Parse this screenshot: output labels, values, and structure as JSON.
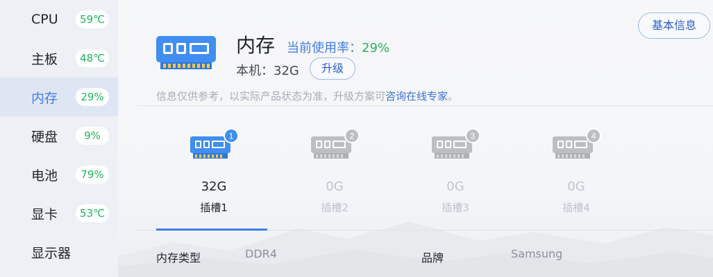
{
  "sidebar": {
    "items": [
      {
        "label": "CPU",
        "badge": "59℃"
      },
      {
        "label": "主板",
        "badge": "48℃"
      },
      {
        "label": "内存",
        "badge": "29%"
      },
      {
        "label": "硬盘",
        "badge": "9%"
      },
      {
        "label": "电池",
        "badge": "79%"
      },
      {
        "label": "显卡",
        "badge": "53℃"
      },
      {
        "label": "显示器",
        "badge": ""
      }
    ],
    "active_index": 2
  },
  "header": {
    "basic_info_label": "基本信息",
    "title": "内存",
    "usage_label": "当前使用率：",
    "usage_value": "29%",
    "local_label": "本机：32G",
    "upgrade_label": "升级"
  },
  "notice": {
    "text": "信息仅供参考，以实际产品状态为准，升级方案可",
    "link": "咨询在线专家",
    "suffix": "。"
  },
  "slots": [
    {
      "number": "1",
      "size": "32G",
      "name": "插槽1",
      "installed": true
    },
    {
      "number": "2",
      "size": "0G",
      "name": "插槽2",
      "installed": false
    },
    {
      "number": "3",
      "size": "0G",
      "name": "插槽3",
      "installed": false
    },
    {
      "number": "4",
      "size": "0G",
      "name": "插槽4",
      "installed": false
    }
  ],
  "details": {
    "type_label": "内存类型",
    "type_value": "DDR4",
    "brand_label": "品牌",
    "brand_value": "Samsung"
  },
  "colors": {
    "accent": "#3f7de8",
    "good": "#22b35e",
    "ram_active": "#3f8ef0",
    "ram_inactive": "#bcbec2"
  }
}
